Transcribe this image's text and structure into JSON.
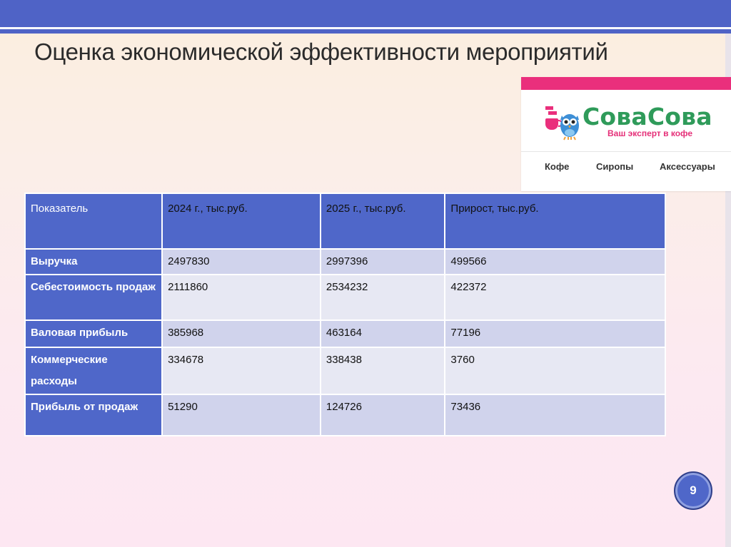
{
  "slide": {
    "title": "Оценка экономической эффективности мероприятий",
    "page_number": "9"
  },
  "logo": {
    "brand": "СоваСова",
    "tagline": "Ваш эксперт в кофе",
    "nav": [
      "Кофе",
      "Сиропы",
      "Аксессуары"
    ],
    "colors": {
      "pink": "#ea2f7c",
      "green": "#2f9b5a",
      "owl_blue": "#3e8fd6"
    }
  },
  "table": {
    "headers": [
      "Показатель",
      "2024 г., тыс.руб.",
      "2025 г., тыс.руб.",
      "Прирост, тыс.руб."
    ],
    "rows": [
      {
        "label": "Выручка",
        "values": [
          "2497830",
          "2997396",
          "499566"
        ]
      },
      {
        "label": "Себестоимость продаж",
        "values": [
          "2111860",
          "2534232",
          "422372"
        ]
      },
      {
        "label": "Валовая прибыль",
        "values": [
          "385968",
          "463164",
          "77196"
        ]
      },
      {
        "label": "Коммерческие расходы",
        "values": [
          "334678",
          "338438",
          "3760"
        ]
      },
      {
        "label": "Прибыль от продаж",
        "values": [
          "51290",
          "124726",
          "73436"
        ]
      }
    ]
  },
  "colors": {
    "accent": "#4f67c9",
    "row_odd": "#d0d3ec",
    "row_even": "#e7e8f3"
  }
}
